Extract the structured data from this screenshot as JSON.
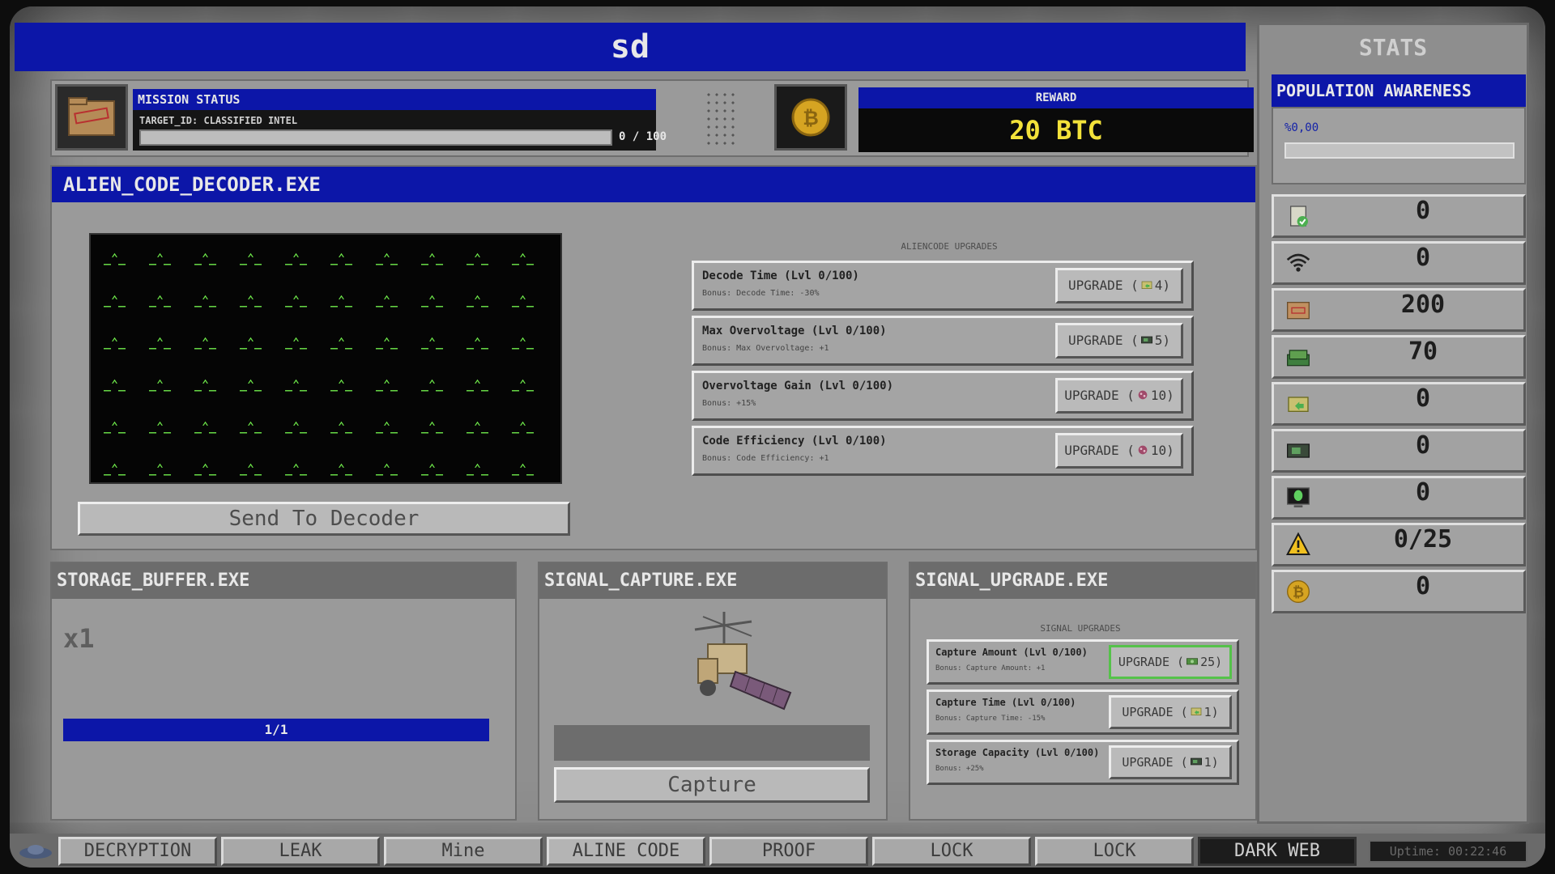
{
  "window": {
    "title": "sd"
  },
  "mission": {
    "status_label": "MISSION STATUS",
    "target": "TARGET_ID: CLASSIFIED INTEL",
    "progress_text": "0 / 100",
    "progress": 0,
    "reward_label": "REWARD",
    "reward_value": "20 BTC"
  },
  "decoder": {
    "title": "ALIEN_CODE_DECODER.EXE",
    "glyph": "_⌃_",
    "send_button": "Send To Decoder",
    "upgrades_title": "ALIENCODE UPGRADES",
    "upgrades": [
      {
        "name": "Decode Time (Lvl 0/100)",
        "bonus": "Bonus: Decode Time: -30%",
        "btn_prefix": "UPGRADE (",
        "cost": "4)",
        "icon": "folder-arrow-icon"
      },
      {
        "name": "Max Overvoltage (Lvl 0/100)",
        "bonus": "Bonus: Max Overvoltage: +1",
        "btn_prefix": "UPGRADE (",
        "cost": "5)",
        "icon": "gpu-icon"
      },
      {
        "name": "Overvoltage Gain (Lvl 0/100)",
        "bonus": "Bonus: +15%",
        "btn_prefix": "UPGRADE (",
        "cost": "10)",
        "icon": "alien-orb-icon"
      },
      {
        "name": "Code Efficiency (Lvl 0/100)",
        "bonus": "Bonus: Code Efficiency: +1",
        "btn_prefix": "UPGRADE (",
        "cost": "10)",
        "icon": "alien-orb-icon"
      }
    ]
  },
  "storage": {
    "title": "STORAGE_BUFFER.EXE",
    "multiplier": "x1",
    "bar_text": "1/1",
    "fill": 1
  },
  "capture": {
    "title": "SIGNAL_CAPTURE.EXE",
    "button": "Capture",
    "progress": 0
  },
  "signal_upgrades": {
    "title": "SIGNAL_UPGRADE.EXE",
    "subtitle": "SIGNAL UPGRADES",
    "items": [
      {
        "name": "Capture Amount (Lvl 0/100)",
        "bonus": "Bonus: Capture Amount: +1",
        "btn_prefix": "UPGRADE (",
        "cost": "25)",
        "icon": "cash-icon"
      },
      {
        "name": "Capture Time (Lvl 0/100)",
        "bonus": "Bonus: Capture Time: -15%",
        "btn_prefix": "UPGRADE (",
        "cost": "1)",
        "icon": "folder-arrow-icon"
      },
      {
        "name": "Storage Capacity (Lvl 0/100)",
        "bonus": "Bonus: +25%",
        "btn_prefix": "UPGRADE (",
        "cost": "1)",
        "icon": "gpu-icon"
      }
    ]
  },
  "stats": {
    "title": "STATS",
    "population_label": "POPULATION AWARENESS",
    "population_value": "%0,00",
    "population_fraction": 0,
    "rows": [
      {
        "icon": "document-check-icon",
        "value": "0"
      },
      {
        "icon": "wifi-signal-icon",
        "value": "0"
      },
      {
        "icon": "classified-folder-icon",
        "value": "200"
      },
      {
        "icon": "cash-stack-icon",
        "value": "70"
      },
      {
        "icon": "folder-arrow-icon",
        "value": "0"
      },
      {
        "icon": "gpu-icon",
        "value": "0"
      },
      {
        "icon": "alien-monitor-icon",
        "value": "0"
      },
      {
        "icon": "warning-icon",
        "value": "0/25"
      },
      {
        "icon": "bitcoin-icon",
        "value": "0"
      }
    ]
  },
  "taskbar": {
    "tabs": [
      "DECRYPTION",
      "LEAK",
      "Mine",
      "ALINE CODE",
      "PROOF",
      "LOCK",
      "LOCK",
      "DARK WEB"
    ],
    "selected": "ALINE CODE",
    "active": "DARK WEB",
    "uptime": "Uptime: 00:22:46"
  },
  "colors": {
    "accent_blue": "#0c16a8",
    "reward_yellow": "#f3e23a",
    "glyph_green": "#6ee84a"
  }
}
